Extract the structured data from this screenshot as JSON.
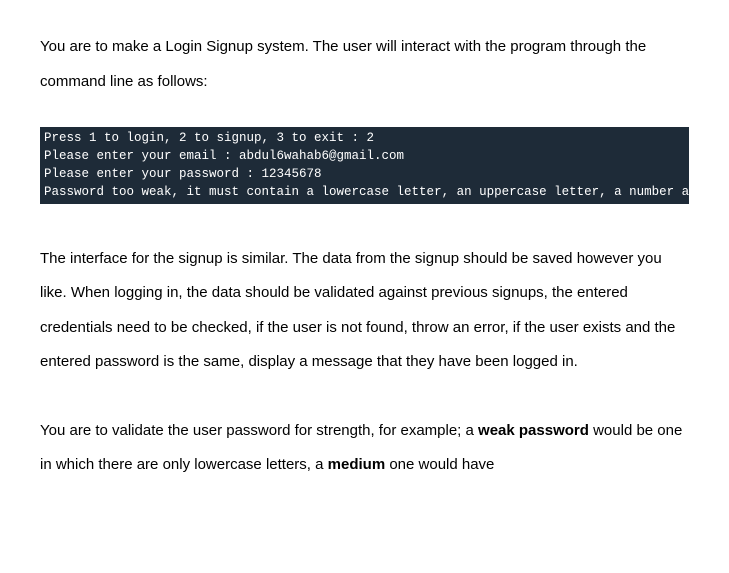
{
  "intro": "You are to make a Login Signup system. The user will interact with the program through the command line as follows:",
  "terminal": {
    "line1": "Press 1 to login, 2 to signup, 3 to exit : 2",
    "line2": "Please enter your email : abdul6wahab6@gmail.com",
    "line3": "Please enter your password : 12345678",
    "line4": "Password too weak, it must contain a lowercase letter, an uppercase letter, a number and a special character"
  },
  "para2": "The interface for the signup is similar. The data from the signup should be saved however you like. When logging in, the data should be validated against previous signups, the entered credentials need to be checked, if the user is not found, throw an error, if the user exists and the entered password is the same, display a message that they have been logged in.",
  "para3_part1": "You are to validate the user password for strength, for example; a ",
  "para3_bold1": "weak password",
  "para3_part2": " would be one in which there are only lowercase letters, a ",
  "para3_bold2": "medium",
  "para3_part3": " one would have"
}
